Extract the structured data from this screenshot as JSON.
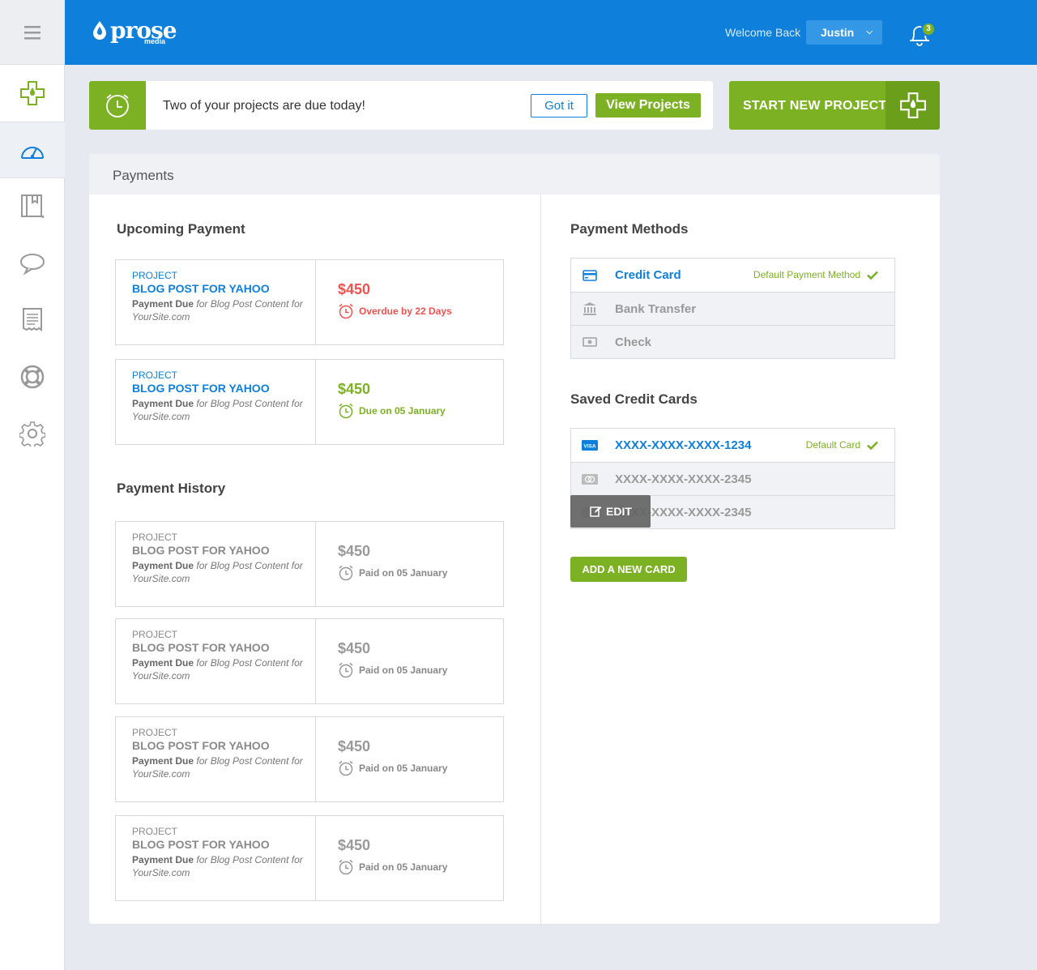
{
  "brand": {
    "name": "prose",
    "sub": "media"
  },
  "header": {
    "welcome": "Welcome Back",
    "user": "Justin",
    "notification_count": "3"
  },
  "notice": {
    "text": "Two of your projects are due today!",
    "got_it": "Got it",
    "view_projects": "View Projects"
  },
  "start_new": "START NEW PROJECT",
  "panel_title": "Payments",
  "upcoming": {
    "title": "Upcoming Payment",
    "cards": [
      {
        "kicker": "PROJECT",
        "title": "BLOG POST FOR YAHOO",
        "desc_bold": "Payment Due",
        "desc": " for Blog Post Content for YourSite.com",
        "amount": "$450",
        "status": "Overdue by 22 Days"
      },
      {
        "kicker": "PROJECT",
        "title": "BLOG POST FOR YAHOO",
        "desc_bold": "Payment Due",
        "desc": " for Blog Post Content for YourSite.com",
        "amount": "$450",
        "status": "Due on 05 January"
      }
    ]
  },
  "history": {
    "title": "Payment History",
    "cards": [
      {
        "kicker": "PROJECT",
        "title": "BLOG POST FOR YAHOO",
        "desc_bold": "Payment Due",
        "desc": " for Blog Post Content for YourSite.com",
        "amount": "$450",
        "status": "Paid on 05 January"
      },
      {
        "kicker": "PROJECT",
        "title": "BLOG POST FOR YAHOO",
        "desc_bold": "Payment Due",
        "desc": " for Blog Post Content for YourSite.com",
        "amount": "$450",
        "status": "Paid on 05 January"
      },
      {
        "kicker": "PROJECT",
        "title": "BLOG POST FOR YAHOO",
        "desc_bold": "Payment Due",
        "desc": " for Blog Post Content for YourSite.com",
        "amount": "$450",
        "status": "Paid on 05 January"
      },
      {
        "kicker": "PROJECT",
        "title": "BLOG POST FOR YAHOO",
        "desc_bold": "Payment Due",
        "desc": " for Blog Post Content for YourSite.com",
        "amount": "$450",
        "status": "Paid on 05 January"
      }
    ]
  },
  "methods": {
    "title": "Payment Methods",
    "items": [
      {
        "label": "Credit Card",
        "icon": "credit-card-icon",
        "default": "Default Payment Method"
      },
      {
        "label": "Bank Transfer",
        "icon": "bank-icon"
      },
      {
        "label": "Check",
        "icon": "cash-icon"
      }
    ]
  },
  "cards": {
    "title": "Saved Credit Cards",
    "items": [
      {
        "number": "XXXX-XXXX-XXXX-1234",
        "icon": "visa-icon",
        "default": "Default Card"
      },
      {
        "number": "XXXX-XXXX-XXXX-2345",
        "icon": "mastercard-icon"
      },
      {
        "number": "XXXX-XXXX-XXXX-2345",
        "icon": "card-icon"
      }
    ],
    "edit": "EDIT",
    "add": "ADD A NEW CARD"
  },
  "colors": {
    "primary": "#0e7fdb",
    "accent": "#7cb124",
    "danger": "#ef5350"
  }
}
